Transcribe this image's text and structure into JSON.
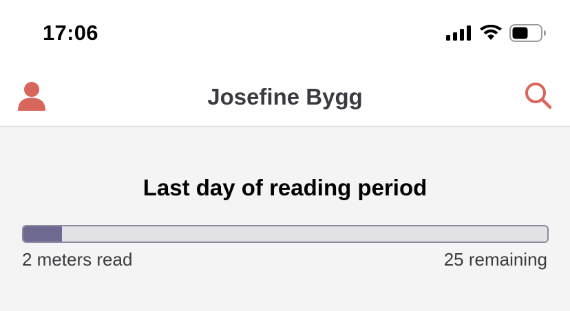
{
  "status_bar": {
    "time": "17:06",
    "icons": [
      "cellular-signal-icon",
      "wifi-icon",
      "battery-icon"
    ]
  },
  "header": {
    "title": "Josefine Bygg",
    "left_icon": "profile-icon",
    "right_icon": "search-icon",
    "accent_color": "#d9665a"
  },
  "reading_period": {
    "title": "Last day of reading period",
    "read_label": "2 meters read",
    "remaining_label": "25 remaining",
    "read_meters": 2,
    "remaining_meters": 25,
    "progress_fraction": 0.074,
    "track_color": "#e2e1e6",
    "fill_color": "#6d6990"
  }
}
